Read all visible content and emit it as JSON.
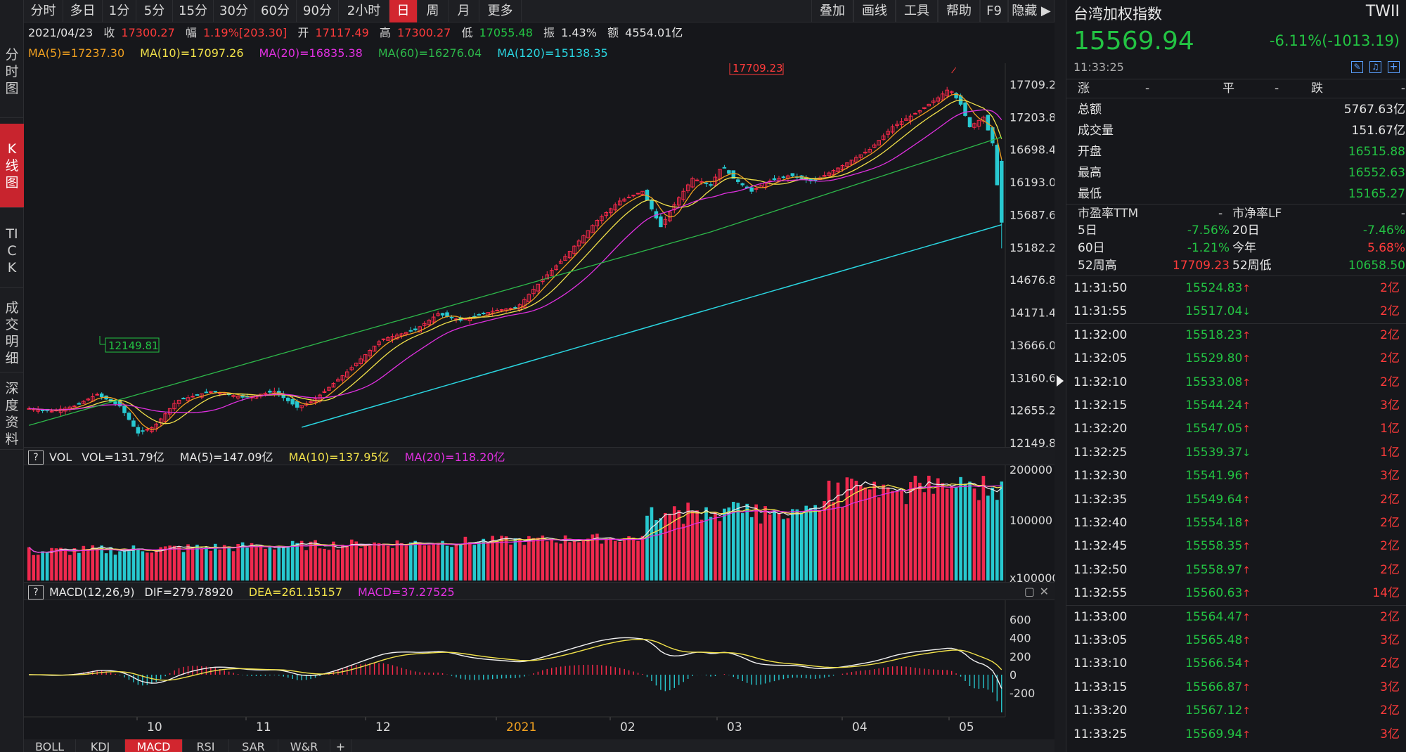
{
  "toolbar": {
    "left_items": [
      "分时",
      "多日",
      "1分",
      "5分",
      "15分",
      "30分",
      "60分",
      "90分",
      "2小时",
      "日",
      "周",
      "月",
      "更多"
    ],
    "active": "日",
    "right_items": [
      "叠加",
      "画线",
      "工具",
      "帮助",
      "F9",
      "隐藏 ▶"
    ]
  },
  "vtabs": [
    {
      "label": "分时图",
      "active": false
    },
    {
      "label": "K线图",
      "active": true
    },
    {
      "label": "TICK",
      "active": false
    },
    {
      "label": "成交明细",
      "active": false
    },
    {
      "label": "深度资料",
      "active": false
    }
  ],
  "info": {
    "date": "2021/04/23",
    "close_label": "收",
    "close": "17300.27",
    "range_label": "幅",
    "range": "1.19%[203.30]",
    "open_label": "开",
    "open": "17117.49",
    "high_label": "高",
    "high": "17300.27",
    "low_label": "低",
    "low": "17055.48",
    "amp_label": "振",
    "amp": "1.43%",
    "amount_label": "额",
    "amount": "4554.01亿"
  },
  "ma": [
    {
      "text": "MA(5)=17237.30",
      "color": "#f0a020"
    },
    {
      "text": "MA(10)=17097.26",
      "color": "#f2e24a"
    },
    {
      "text": "MA(20)=16835.38",
      "color": "#e030e0"
    },
    {
      "text": "MA(60)=16276.04",
      "color": "#2db84a"
    },
    {
      "text": "MA(120)=15138.35",
      "color": "#2ad5e0"
    }
  ],
  "price_axis": [
    "17709.23",
    "17203.83",
    "16698.43",
    "16193.02",
    "15687.62",
    "15182.22",
    "14676.82",
    "14171.42",
    "13666.02",
    "13160.61",
    "12655.21",
    "12149.81"
  ],
  "price_range": [
    12149.81,
    17709.23
  ],
  "max_label": "17709.23",
  "min_label": "12149.81",
  "vol_bar": {
    "q": "?",
    "name": "VOL",
    "items": [
      {
        "text": "VOL=131.79亿",
        "color": "#e6e6e6"
      },
      {
        "text": "MA(5)=147.09亿",
        "color": "#e6e6e6"
      },
      {
        "text": "MA(10)=137.95亿",
        "color": "#f2e24a"
      },
      {
        "text": "MA(20)=118.20亿",
        "color": "#e030e0"
      }
    ]
  },
  "vol_axis": [
    "200000",
    "100000",
    "x100000"
  ],
  "macd_bar": {
    "q": "?",
    "name": "MACD(12,26,9)",
    "items": [
      {
        "text": "DIF=279.78920",
        "color": "#e6e6e6"
      },
      {
        "text": "DEA=261.15157",
        "color": "#f2e24a"
      },
      {
        "text": "MACD=37.27525",
        "color": "#e030e0"
      }
    ]
  },
  "macd_axis": [
    "600",
    "400",
    "200",
    "0",
    "-200"
  ],
  "x_labels": [
    {
      "text": "10",
      "color": "#d8d8d8"
    },
    {
      "text": "11",
      "color": "#d8d8d8"
    },
    {
      "text": "12",
      "color": "#d8d8d8"
    },
    {
      "text": "2021",
      "color": "#f0a020"
    },
    {
      "text": "02",
      "color": "#d8d8d8"
    },
    {
      "text": "03",
      "color": "#d8d8d8"
    },
    {
      "text": "04",
      "color": "#d8d8d8"
    },
    {
      "text": "05",
      "color": "#d8d8d8"
    }
  ],
  "indicator_tabs": [
    "BOLL",
    "KDJ",
    "MACD",
    "RSI",
    "SAR",
    "W&R",
    "+"
  ],
  "indicator_active": "MACD",
  "right": {
    "name": "台湾加权指数",
    "code": "TWII",
    "price": "15569.94",
    "change": "-6.11%(-1013.19)",
    "time": "11:33:25",
    "breadth": {
      "up_label": "涨",
      "up": "-",
      "flat_label": "平",
      "flat": "-",
      "down_label": "跌",
      "down": "-"
    },
    "stats": [
      {
        "label": "总额",
        "value": "5767.63亿",
        "color": "white"
      },
      {
        "label": "成交量",
        "value": "151.67亿",
        "color": "white"
      },
      {
        "label": "开盘",
        "value": "16515.88",
        "color": "green"
      },
      {
        "label": "最高",
        "value": "16552.63",
        "color": "green"
      },
      {
        "label": "最低",
        "value": "15165.27",
        "color": "green"
      }
    ],
    "pe_label": "市盈率TTM",
    "pe": "-",
    "pb_label": "市净率LF",
    "pb": "-",
    "perf": [
      {
        "l1": "5日",
        "v1": "-7.56%",
        "c1": "green",
        "l2": "20日",
        "v2": "-7.46%",
        "c2": "green"
      },
      {
        "l1": "60日",
        "v1": "-1.21%",
        "c1": "green",
        "l2": "今年",
        "v2": "5.68%",
        "c2": "red"
      },
      {
        "l1": "52周高",
        "v1": "17709.23",
        "c1": "red",
        "l2": "52周低",
        "v2": "10658.50",
        "c2": "green"
      }
    ],
    "ticks": [
      {
        "time": "11:31:50",
        "price": "15524.83",
        "dir": "up",
        "vol": "2亿"
      },
      {
        "time": "11:31:55",
        "price": "15517.04",
        "dir": "down",
        "vol": "2亿"
      },
      {
        "time": "11:32:00",
        "price": "15518.23",
        "dir": "up",
        "vol": "2亿"
      },
      {
        "time": "11:32:05",
        "price": "15529.80",
        "dir": "up",
        "vol": "2亿"
      },
      {
        "time": "11:32:10",
        "price": "15533.08",
        "dir": "up",
        "vol": "2亿"
      },
      {
        "time": "11:32:15",
        "price": "15544.24",
        "dir": "up",
        "vol": "3亿"
      },
      {
        "time": "11:32:20",
        "price": "15547.05",
        "dir": "up",
        "vol": "1亿"
      },
      {
        "time": "11:32:25",
        "price": "15539.37",
        "dir": "down",
        "vol": "1亿"
      },
      {
        "time": "11:32:30",
        "price": "15541.96",
        "dir": "up",
        "vol": "3亿"
      },
      {
        "time": "11:32:35",
        "price": "15549.64",
        "dir": "up",
        "vol": "2亿"
      },
      {
        "time": "11:32:40",
        "price": "15554.18",
        "dir": "up",
        "vol": "2亿"
      },
      {
        "time": "11:32:45",
        "price": "15558.35",
        "dir": "up",
        "vol": "2亿"
      },
      {
        "time": "11:32:50",
        "price": "15558.97",
        "dir": "up",
        "vol": "2亿"
      },
      {
        "time": "11:32:55",
        "price": "15560.63",
        "dir": "up",
        "vol": "14亿"
      },
      {
        "time": "11:33:00",
        "price": "15564.47",
        "dir": "up",
        "vol": "2亿"
      },
      {
        "time": "11:33:05",
        "price": "15565.48",
        "dir": "up",
        "vol": "3亿"
      },
      {
        "time": "11:33:10",
        "price": "15566.54",
        "dir": "up",
        "vol": "2亿"
      },
      {
        "time": "11:33:15",
        "price": "15566.87",
        "dir": "up",
        "vol": "3亿"
      },
      {
        "time": "11:33:20",
        "price": "15567.12",
        "dir": "up",
        "vol": "2亿"
      },
      {
        "time": "11:33:25",
        "price": "15569.94",
        "dir": "up",
        "vol": "3亿"
      }
    ]
  }
}
